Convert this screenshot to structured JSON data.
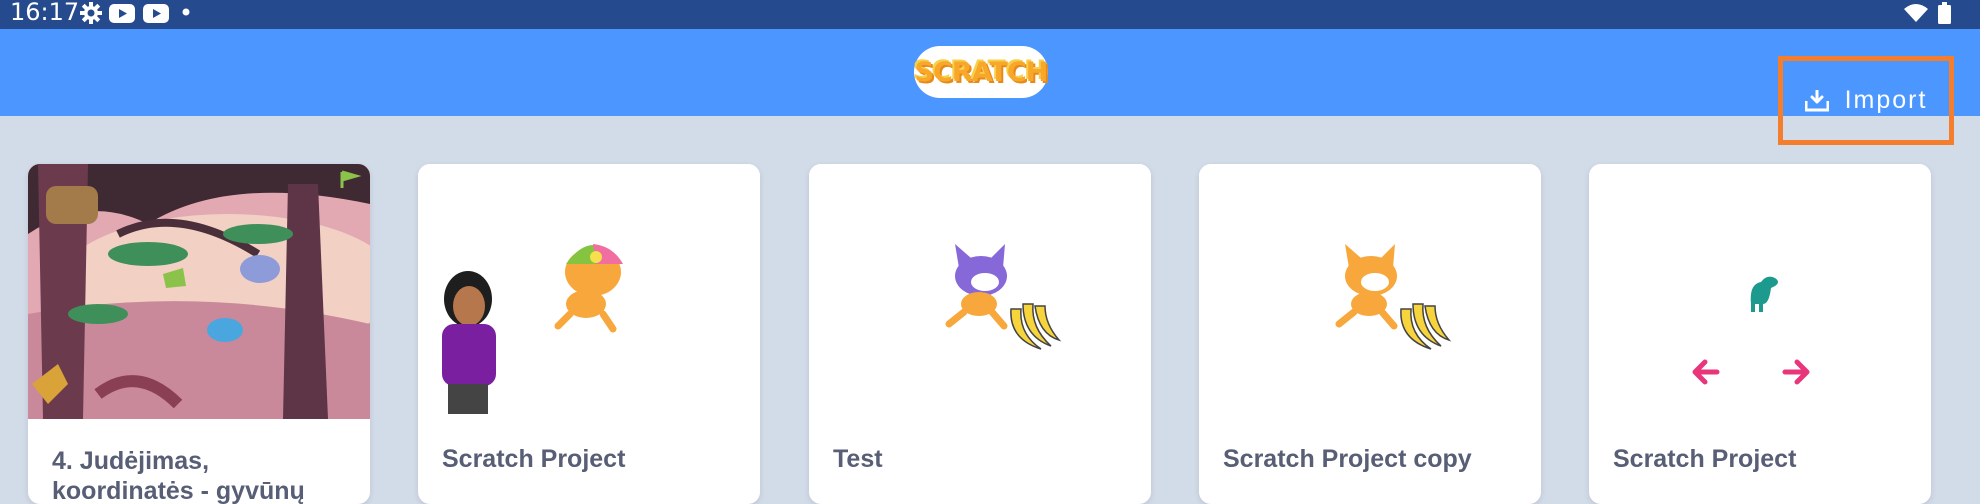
{
  "status_bar": {
    "time": "16:17",
    "icons": [
      "settings-icon",
      "youtube-icon",
      "youtube-icon",
      "dot-icon"
    ],
    "right_icons": [
      "wifi-icon",
      "battery-icon"
    ]
  },
  "header": {
    "logo_text": "SCRATCH",
    "import_label": "Import",
    "import_icon": "download-icon",
    "bar_color": "#4c97ff",
    "highlight_color": "#f47e2c"
  },
  "projects": [
    {
      "title": "4. Judėjimas, koordinatės - gyvūnų"
    },
    {
      "title": "Scratch Project"
    },
    {
      "title": "Test"
    },
    {
      "title": "Scratch Project copy"
    },
    {
      "title": "Scratch Project"
    }
  ]
}
